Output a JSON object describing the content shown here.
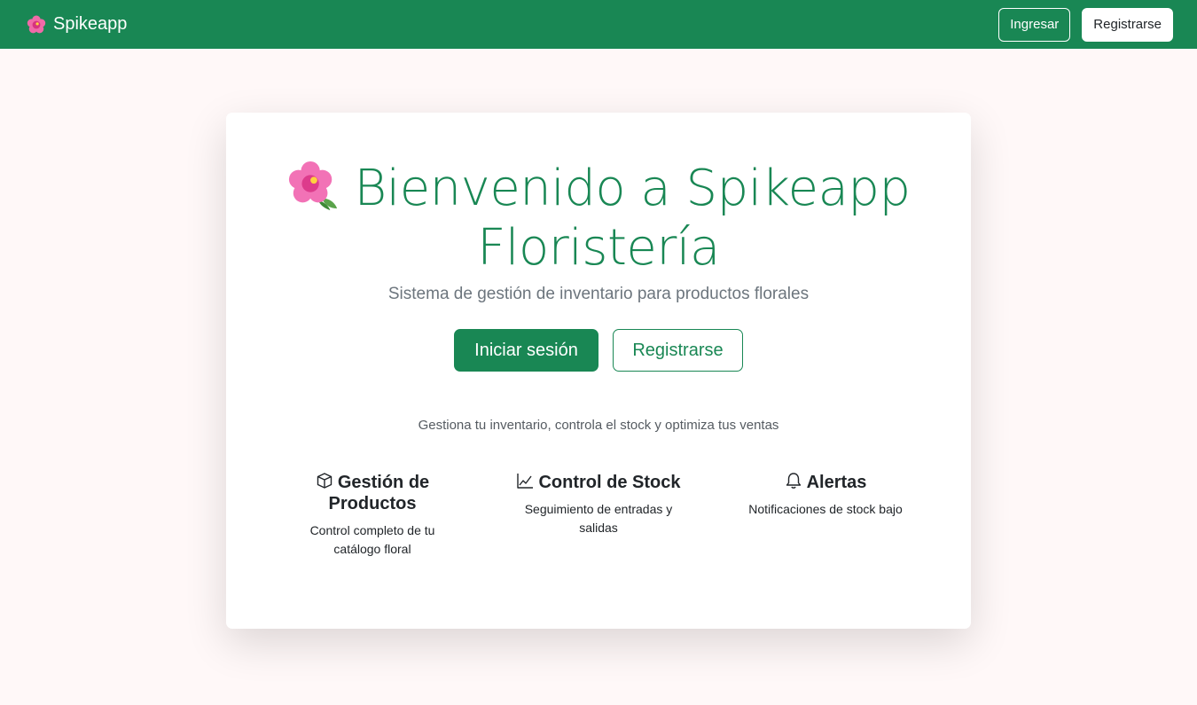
{
  "navbar": {
    "brand": "Spikeapp",
    "brand_icon": "hibiscus-flower-icon",
    "login_button": "Ingresar",
    "register_button": "Registrarse",
    "background_color": "#198754"
  },
  "hero": {
    "title_line1": "Bienvenido a Spikeapp",
    "title_line2": "Floristería",
    "title_icon": "hibiscus-flower-icon",
    "lead": "Sistema de gestión de inventario para productos florales",
    "primary_button": "Iniciar sesión",
    "secondary_button": "Registrarse",
    "tagline": "Gestiona tu inventario, controla el stock y optimiza tus ventas",
    "accent_color": "#198754"
  },
  "features": [
    {
      "icon": "box-icon",
      "title": "Gestión de Productos",
      "description": "Control completo de tu catálogo floral"
    },
    {
      "icon": "line-chart-icon",
      "title": "Control de Stock",
      "description": "Seguimiento de entradas y salidas"
    },
    {
      "icon": "bell-icon",
      "title": "Alertas",
      "description": "Notificaciones de stock bajo"
    }
  ]
}
